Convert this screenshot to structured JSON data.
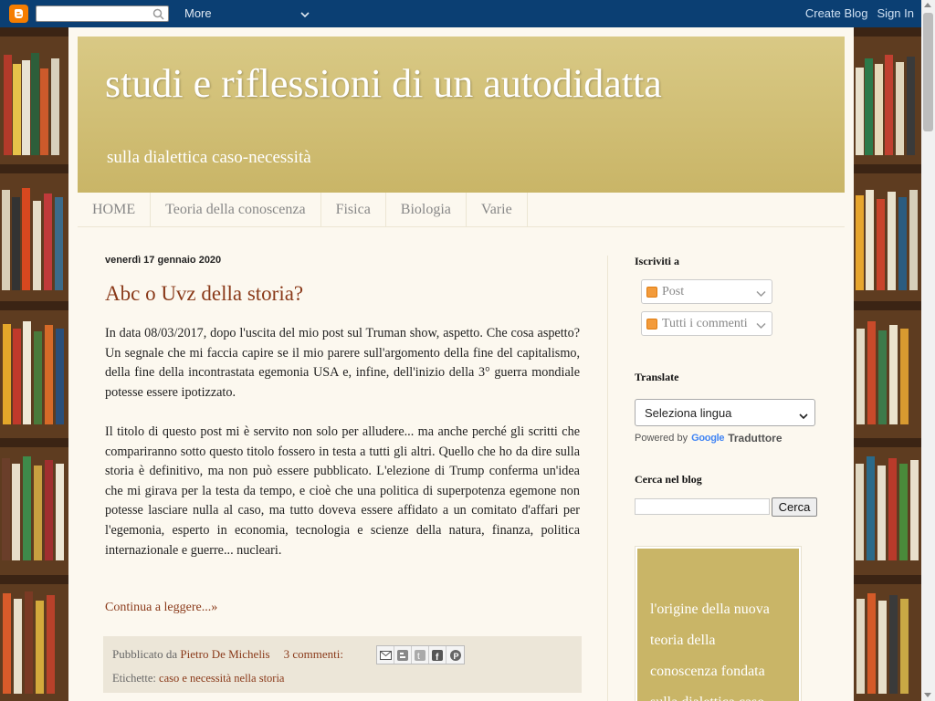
{
  "navbar": {
    "more_label": "More",
    "create_blog": "Create Blog",
    "sign_in": "Sign In"
  },
  "blog": {
    "title": "studi e riflessioni di un autodidatta",
    "description": "sulla dialettica caso-necessità"
  },
  "tabs": [
    {
      "label": "HOME"
    },
    {
      "label": "Teoria della conoscenza"
    },
    {
      "label": "Fisica"
    },
    {
      "label": "Biologia"
    },
    {
      "label": "Varie"
    }
  ],
  "post": {
    "date": "venerdì 17 gennaio 2020",
    "title": "Abc o Uvz della storia?",
    "paragraphs": [
      "In data 08/03/2017, dopo l'uscita del mio post sul Truman show, aspetto. Che cosa aspetto? Un segnale che mi faccia capire se il mio parere sull'argomento della fine del capitalismo, della fine della incontrastata egemonia USA e, infine, dell'inizio della 3° guerra mondiale potesse essere ipotizzato.",
      "Il titolo di questo post mi è servito non solo per alludere... ma anche perché gli scritti che compariranno sotto questo titolo fossero in testa a tutti gli altri. Quello che ho da dire sulla storia è definitivo, ma non può essere pubblicato. L'elezione di Trump conferma un'idea che mi girava per la testa da tempo, e cioè che una politica di superpotenza egemone non potesse lasciare nulla al caso, ma tutto doveva essere affidato a un comitato d'affari per l'egemonia, esperto in economia, tecnologia e scienze della natura, finanza, politica internazionale e guerre... nucleari."
    ],
    "read_more": "Continua a leggere...»",
    "published_by_prefix": "Pubblicato da",
    "author": "Pietro De Michelis",
    "comments": "3 commenti:",
    "labels_prefix": "Etichette:",
    "labels": "caso e necessità nella storia"
  },
  "sidebar": {
    "subscribe_heading": "Iscriviti a",
    "feed_posts": "Post",
    "feed_comments": "Tutti i commenti",
    "translate_heading": "Translate",
    "language_select": "Seleziona lingua",
    "powered_by": "Powered by",
    "google": "Google",
    "translator": "Traduttore",
    "search_heading": "Cerca nel blog",
    "search_button": "Cerca",
    "promo_text": "l'origine della nuova teoria della conoscenza fondata sulla dialettica caso-necessità"
  },
  "colors": {
    "navbar": "#0b3f73",
    "header": "#c9b567",
    "link": "#8a3a1a",
    "page_bg": "#fcf8ef"
  }
}
